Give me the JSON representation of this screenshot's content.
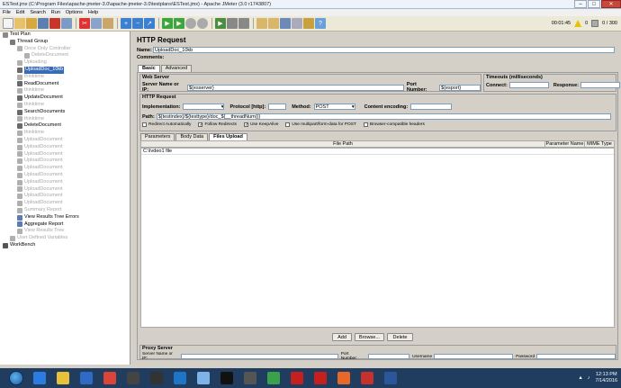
{
  "window": {
    "title": "ESTest.jmx (C:\\Program Files\\apache-jmeter-3.0\\apache-jmeter-3.0\\testplans\\ESTest.jmx) - Apache JMeter (3.0 r1743807)",
    "btn_min": "–",
    "btn_max": "□",
    "btn_close": "✕"
  },
  "menu": [
    "File",
    "Edit",
    "Search",
    "Run",
    "Options",
    "Help"
  ],
  "toolbar": {
    "elapsed": "00:01:45",
    "errors": "0",
    "threads": "0 / 300"
  },
  "tree": [
    {
      "label": "Test Plan",
      "depth": 0,
      "icon": "testplan-icon",
      "dim": false,
      "color": "#8a8a8a"
    },
    {
      "label": "Thread Group",
      "depth": 1,
      "icon": "gear-icon",
      "dim": false,
      "color": "#7a7a7a"
    },
    {
      "label": "Once Only Controller",
      "depth": 2,
      "icon": "controller-icon",
      "dim": true,
      "color": "#b0b0b0"
    },
    {
      "label": "DeleteDocument",
      "depth": 3,
      "icon": "sampler-icon",
      "dim": true,
      "color": "#b0b0b0"
    },
    {
      "label": "Uploading",
      "depth": 2,
      "icon": "sampler-icon",
      "dim": true,
      "color": "#b0b0b0"
    },
    {
      "label": "UploadDoc_10kb",
      "depth": 2,
      "icon": "sampler-icon",
      "dim": false,
      "sel": true,
      "color": "#6a6a6a"
    },
    {
      "label": "thinktime",
      "depth": 2,
      "icon": "timer-icon",
      "dim": true,
      "color": "#b0b0b0"
    },
    {
      "label": "ReadDocument",
      "depth": 2,
      "icon": "sampler-icon",
      "dim": false,
      "color": "#6a6a6a"
    },
    {
      "label": "thinktime",
      "depth": 2,
      "icon": "timer-icon",
      "dim": true,
      "color": "#b0b0b0"
    },
    {
      "label": "UpdateDocument",
      "depth": 2,
      "icon": "sampler-icon",
      "dim": false,
      "color": "#6a6a6a"
    },
    {
      "label": "thinktime",
      "depth": 2,
      "icon": "timer-icon",
      "dim": true,
      "color": "#b0b0b0"
    },
    {
      "label": "SearchDocuments",
      "depth": 2,
      "icon": "sampler-icon",
      "dim": false,
      "color": "#6a6a6a"
    },
    {
      "label": "thinktime",
      "depth": 2,
      "icon": "timer-icon",
      "dim": true,
      "color": "#b0b0b0"
    },
    {
      "label": "DeleteDocument",
      "depth": 2,
      "icon": "sampler-icon",
      "dim": false,
      "color": "#6a6a6a"
    },
    {
      "label": "thinktime",
      "depth": 2,
      "icon": "timer-icon",
      "dim": true,
      "color": "#b0b0b0"
    },
    {
      "label": "UploadDocument",
      "depth": 2,
      "icon": "sampler-icon",
      "dim": true,
      "color": "#b0b0b0"
    },
    {
      "label": "UploadDocument",
      "depth": 2,
      "icon": "sampler-icon",
      "dim": true,
      "color": "#b0b0b0"
    },
    {
      "label": "UploadDocument",
      "depth": 2,
      "icon": "sampler-icon",
      "dim": true,
      "color": "#b0b0b0"
    },
    {
      "label": "UploadDocument",
      "depth": 2,
      "icon": "sampler-icon",
      "dim": true,
      "color": "#b0b0b0"
    },
    {
      "label": "UploadDocument",
      "depth": 2,
      "icon": "sampler-icon",
      "dim": true,
      "color": "#b0b0b0"
    },
    {
      "label": "UploadDocument",
      "depth": 2,
      "icon": "sampler-icon",
      "dim": true,
      "color": "#b0b0b0"
    },
    {
      "label": "UploadDocument",
      "depth": 2,
      "icon": "sampler-icon",
      "dim": true,
      "color": "#b0b0b0"
    },
    {
      "label": "UploadDocument",
      "depth": 2,
      "icon": "sampler-icon",
      "dim": true,
      "color": "#b0b0b0"
    },
    {
      "label": "UploadDocument",
      "depth": 2,
      "icon": "sampler-icon",
      "dim": true,
      "color": "#b0b0b0"
    },
    {
      "label": "UploadDocument",
      "depth": 2,
      "icon": "sampler-icon",
      "dim": true,
      "color": "#b0b0b0"
    },
    {
      "label": "Summary Report",
      "depth": 2,
      "icon": "report-icon",
      "dim": true,
      "color": "#b0b0b0"
    },
    {
      "label": "View Results Tree Errors",
      "depth": 2,
      "icon": "report-icon",
      "dim": false,
      "color": "#5b7bb5"
    },
    {
      "label": "Aggregate Report",
      "depth": 2,
      "icon": "report-icon",
      "dim": false,
      "color": "#5b7bb5"
    },
    {
      "label": "View Results Tree",
      "depth": 2,
      "icon": "report-icon",
      "dim": true,
      "color": "#b0b0b0"
    },
    {
      "label": "User Defined Variables",
      "depth": 1,
      "icon": "config-icon",
      "dim": true,
      "color": "#b0b0b0"
    },
    {
      "label": "WorkBench",
      "depth": 0,
      "icon": "workbench-icon",
      "dim": false,
      "color": "#555555"
    }
  ],
  "form": {
    "heading": "HTTP Request",
    "name_label": "Name:",
    "name_value": "UploadDoc_10kb",
    "comments_label": "Comments:",
    "comments_value": "",
    "tabs": [
      "Basic",
      "Advanced"
    ],
    "web_server": "Web Server",
    "server_label": "Server Name or IP:",
    "server_value": "${esserver}",
    "port_label": "Port Number:",
    "port_value": "${esport}",
    "timeouts": "Timeouts (milliseconds)",
    "connect_label": "Connect:",
    "connect_value": "",
    "response_label": "Response:",
    "response_value": "",
    "http_request": "HTTP Request",
    "impl_label": "Implementation:",
    "impl_value": "",
    "protocol_label": "Protocol [http]:",
    "protocol_value": "",
    "method_label": "Method:",
    "method_value": "POST",
    "encoding_label": "Content encoding:",
    "encoding_value": "",
    "path_label": "Path:",
    "path_value": "${testindex}/${testtype}/doc_${__threadNum()}",
    "checks": [
      {
        "label": "Redirect Automatically",
        "checked": false
      },
      {
        "label": "Follow Redirects",
        "checked": true
      },
      {
        "label": "Use KeepAlive",
        "checked": true
      },
      {
        "label": "Use multipart/form-data for POST",
        "checked": false
      },
      {
        "label": "Browser-compatible headers",
        "checked": false
      }
    ],
    "subtabs": [
      "Parameters",
      "Body Data",
      "Files Upload"
    ],
    "table_headers": [
      "File Path",
      "Parameter Name",
      "MIME Type"
    ],
    "table_rows": [
      [
        "C:\\Ivdeo1 file",
        "",
        ""
      ]
    ],
    "add_btn": "Add",
    "browse_btn": "Browse...",
    "delete_btn": "Delete",
    "proxy": "Proxy Server",
    "proxy_server_label": "Server Name or IP:",
    "proxy_port_label": "Port Number:",
    "proxy_user_label": "Username",
    "proxy_pass_label": "Password"
  },
  "taskbar": {
    "time": "12:13 PM",
    "date": "7/14/2016",
    "apps": [
      "ie-icon",
      "explorer-icon",
      "outlook-icon",
      "chrome-icon",
      "media-icon",
      "terminal-icon",
      "lync-icon",
      "notepad-icon",
      "cmd-icon",
      "app-icon",
      "evernote-icon",
      "acrobat-icon",
      "acrobat2-icon",
      "firefox-icon",
      "jmeter-icon",
      "word-icon"
    ]
  }
}
